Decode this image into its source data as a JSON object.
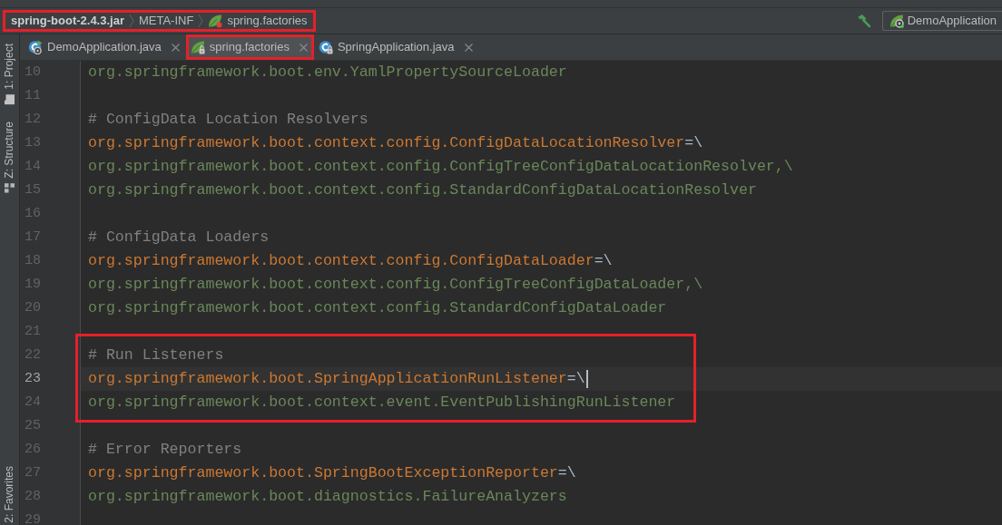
{
  "navigation_bar": {
    "outlined": true,
    "breadcrumbs": [
      {
        "label": "spring-boot-2.4.3.jar",
        "kind": "archive"
      },
      {
        "label": "META-INF",
        "kind": "folder"
      },
      {
        "label": "spring.factories",
        "kind": "spring-file"
      }
    ]
  },
  "toolbar": {
    "run_configuration": "DemoApplication"
  },
  "tool_window_bar": {
    "top": [
      {
        "label": "1: Project",
        "kind": "project"
      },
      {
        "label": "Z: Structure",
        "kind": "structure"
      }
    ],
    "bottom": [
      {
        "label": "2: Favorites"
      }
    ]
  },
  "tabs": [
    {
      "label": "DemoApplication.java",
      "kind": "spring-app",
      "selected": false,
      "outlined": false
    },
    {
      "label": "spring.factories",
      "kind": "spring-file-locked",
      "selected": true,
      "outlined": true
    },
    {
      "label": "SpringApplication.java",
      "kind": "class-locked",
      "selected": false,
      "outlined": false
    }
  ],
  "editor": {
    "lines": [
      {
        "number": "10",
        "kind": "value",
        "text": "org.springframework.boot.env.YamlPropertySourceLoader",
        "current": false,
        "outlined": false
      },
      {
        "number": "11",
        "kind": "blank",
        "current": false,
        "outlined": false
      },
      {
        "number": "12",
        "kind": "comment",
        "text": "# ConfigData Location Resolvers",
        "current": false,
        "outlined": false
      },
      {
        "number": "13",
        "kind": "key",
        "text": "org.springframework.boot.context.config.ConfigDataLocationResolver",
        "separator": "=\\",
        "current": false,
        "outlined": false
      },
      {
        "number": "14",
        "kind": "value",
        "text": "org.springframework.boot.context.config.ConfigTreeConfigDataLocationResolver,\\",
        "current": false,
        "outlined": false
      },
      {
        "number": "15",
        "kind": "value",
        "text": "org.springframework.boot.context.config.StandardConfigDataLocationResolver",
        "current": false,
        "outlined": false
      },
      {
        "number": "16",
        "kind": "blank",
        "current": false,
        "outlined": false
      },
      {
        "number": "17",
        "kind": "comment",
        "text": "# ConfigData Loaders",
        "current": false,
        "outlined": false
      },
      {
        "number": "18",
        "kind": "key",
        "text": "org.springframework.boot.context.config.ConfigDataLoader",
        "separator": "=\\",
        "current": false,
        "outlined": false
      },
      {
        "number": "19",
        "kind": "value",
        "text": "org.springframework.boot.context.config.ConfigTreeConfigDataLoader,\\",
        "current": false,
        "outlined": false
      },
      {
        "number": "20",
        "kind": "value",
        "text": "org.springframework.boot.context.config.StandardConfigDataLoader",
        "current": false,
        "outlined": false
      },
      {
        "number": "21",
        "kind": "blank",
        "current": false,
        "outlined": false
      },
      {
        "number": "22",
        "kind": "comment",
        "text": "# Run Listeners",
        "current": false,
        "outlined": true
      },
      {
        "number": "23",
        "kind": "key",
        "text": "org.springframework.boot.SpringApplicationRunListener",
        "separator": "=\\",
        "current": true,
        "outlined": true
      },
      {
        "number": "24",
        "kind": "value",
        "text": "org.springframework.boot.context.event.EventPublishingRunListener",
        "current": false,
        "outlined": true
      },
      {
        "number": "25",
        "kind": "blank",
        "current": false,
        "outlined": false
      },
      {
        "number": "26",
        "kind": "comment",
        "text": "# Error Reporters",
        "current": false,
        "outlined": false
      },
      {
        "number": "27",
        "kind": "key",
        "text": "org.springframework.boot.SpringBootExceptionReporter",
        "separator": "=\\",
        "current": false,
        "outlined": false
      },
      {
        "number": "28",
        "kind": "value",
        "text": "org.springframework.boot.diagnostics.FailureAnalyzers",
        "current": false,
        "outlined": false
      },
      {
        "number": "29",
        "kind": "blank",
        "current": false,
        "outlined": false
      }
    ]
  }
}
